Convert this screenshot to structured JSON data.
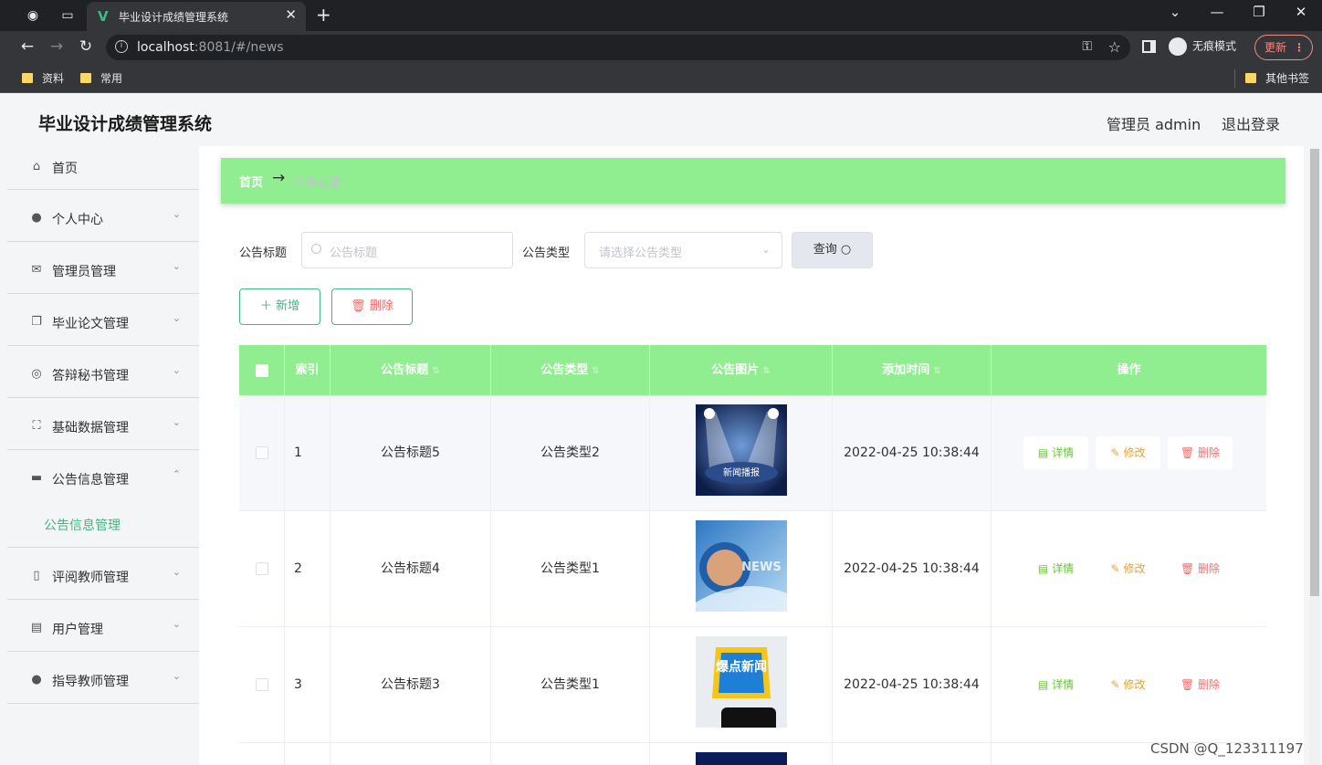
{
  "browser": {
    "tab_title": "毕业设计成绩管理系统",
    "url_host": "localhost",
    "url_rest": ":8081/#/news",
    "incognito_label": "无痕模式",
    "update_label": "更新",
    "bookmarks": [
      "资料",
      "常用"
    ],
    "other_bookmarks": "其他书签"
  },
  "header": {
    "app_title": "毕业设计成绩管理系统",
    "user": "管理员 admin",
    "logout": "退出登录"
  },
  "sidebar": {
    "items": [
      {
        "label": "首页",
        "icon": "home-icon"
      },
      {
        "label": "个人中心",
        "icon": "user-icon"
      },
      {
        "label": "管理员管理",
        "icon": "mail-icon"
      },
      {
        "label": "毕业论文管理",
        "icon": "copy-icon"
      },
      {
        "label": "答辩秘书管理",
        "icon": "lifebuoy-icon"
      },
      {
        "label": "基础数据管理",
        "icon": "fullscreen-icon"
      },
      {
        "label": "公告信息管理",
        "icon": "monitor-icon"
      },
      {
        "label": "评阅教师管理",
        "icon": "microphone-icon"
      },
      {
        "label": "用户管理",
        "icon": "clipboard-icon"
      },
      {
        "label": "指导教师管理",
        "icon": "bulb-icon"
      }
    ],
    "sub_item": "公告信息管理"
  },
  "breadcrumb": {
    "home": "首页",
    "arrow": "→",
    "current": "公告信息"
  },
  "search": {
    "title_label": "公告标题",
    "title_placeholder": "公告标题",
    "type_label": "公告类型",
    "type_placeholder": "请选择公告类型",
    "query_button": "查询"
  },
  "actions": {
    "add": "新增",
    "delete": "删除"
  },
  "table": {
    "headers": [
      "索引",
      "公告标题",
      "公告类型",
      "公告图片",
      "添加时间",
      "操作"
    ],
    "rows": [
      {
        "index": "1",
        "title": "公告标题5",
        "type": "公告类型2",
        "image_text": "新闻播报",
        "time": "2022-04-25 10:38:44"
      },
      {
        "index": "2",
        "title": "公告标题4",
        "type": "公告类型1",
        "image_text": "NEWS",
        "time": "2022-04-25 10:38:44"
      },
      {
        "index": "3",
        "title": "公告标题3",
        "type": "公告类型1",
        "image_text": "爆点新闻",
        "time": "2022-04-25 10:38:44"
      }
    ],
    "op_detail": "详情",
    "op_edit": "修改",
    "op_remove": "删除"
  },
  "watermark": "CSDN @Q_123311197"
}
